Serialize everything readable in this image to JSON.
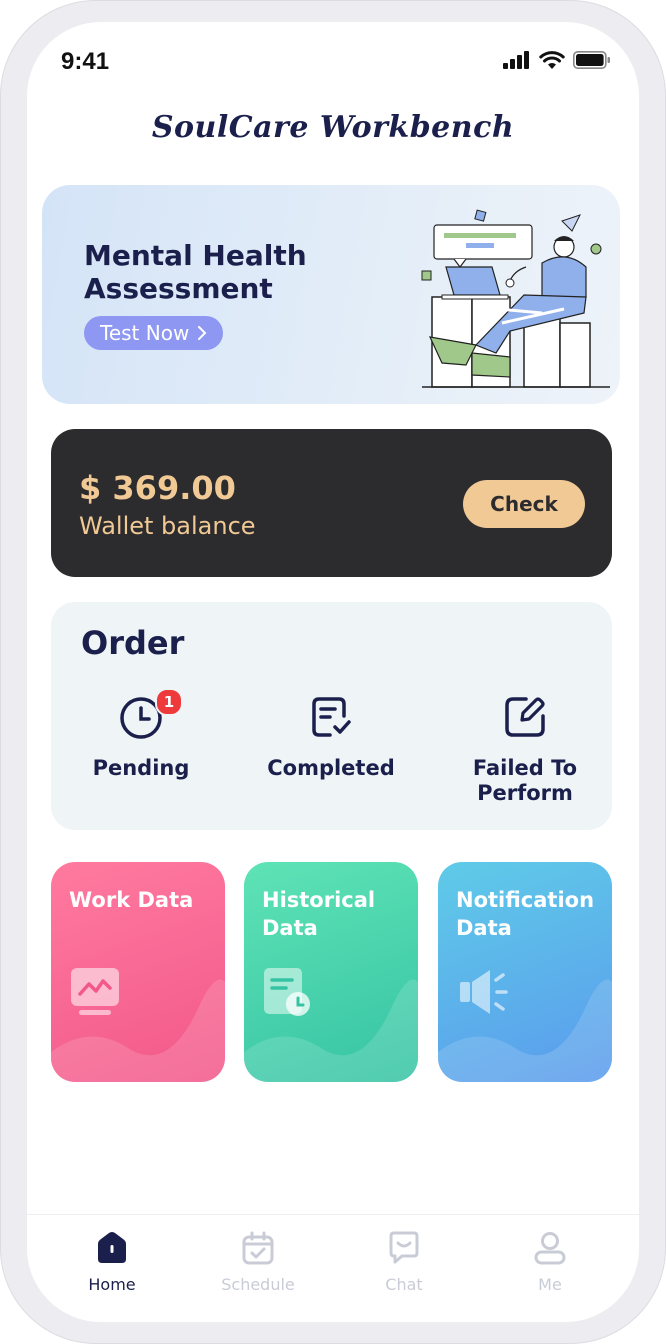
{
  "status_bar": {
    "time": "9:41"
  },
  "app": {
    "title": "SoulCare Workbench"
  },
  "banner": {
    "title": "Mental Health Assessment",
    "button_label": "Test Now"
  },
  "wallet": {
    "amount": "$ 369.00",
    "label": "Wallet balance",
    "button_label": "Check"
  },
  "order": {
    "title": "Order",
    "items": [
      {
        "label": "Pending",
        "icon": "clock-icon",
        "badge": "1"
      },
      {
        "label": "Completed",
        "icon": "note-check-icon"
      },
      {
        "label": "Failed To Perform",
        "icon": "edit-icon"
      }
    ]
  },
  "data_cards": [
    {
      "label": "Work Data",
      "icon": "chart-monitor-icon",
      "color": "#f2588a"
    },
    {
      "label": "Historical Data",
      "icon": "document-clock-icon",
      "color": "#36c3a4"
    },
    {
      "label": "Notification Data",
      "icon": "speaker-icon",
      "color": "#5a9bed"
    }
  ],
  "tabs": [
    {
      "label": "Home",
      "icon": "home-icon",
      "active": true
    },
    {
      "label": "Schedule",
      "icon": "calendar-icon",
      "active": false
    },
    {
      "label": "Chat",
      "icon": "chat-icon",
      "active": false
    },
    {
      "label": "Me",
      "icon": "user-icon",
      "active": false
    }
  ],
  "colors": {
    "primary": "#1b1f4b",
    "accent": "#8e97f2",
    "wallet_bg": "#2c2b2e",
    "wallet_gold": "#f0c995",
    "inactive_tab": "#c9ccd6"
  }
}
